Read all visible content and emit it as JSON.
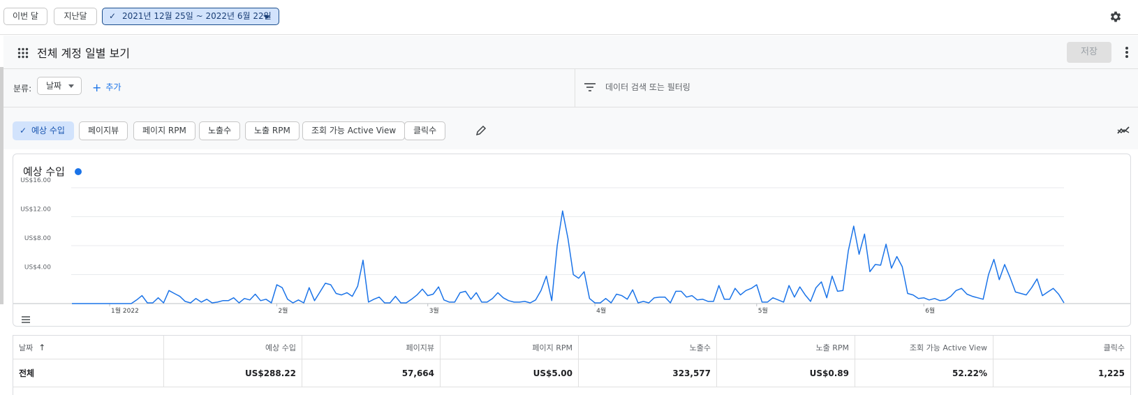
{
  "date_bar": {
    "this_month": "이번 달",
    "last_month": "지난달",
    "range": "2021년 12월 25일 ~ 2022년 6월 22일"
  },
  "report": {
    "title": "전체 계정 일별 보기",
    "save_label": "저장"
  },
  "filters": {
    "breakdown_label": "분류:",
    "breakdown_value": "날짜",
    "add_label": "추가",
    "search_placeholder": "데이터 검색 또는 필터링"
  },
  "metrics": [
    {
      "label": "예상 수입",
      "active": true
    },
    {
      "label": "페이지뷰",
      "active": false
    },
    {
      "label": "페이지 RPM",
      "active": false
    },
    {
      "label": "노출수",
      "active": false
    },
    {
      "label": "노출 RPM",
      "active": false
    },
    {
      "label": "조회 가능 Active View",
      "active": false
    },
    {
      "label": "클릭수",
      "active": false
    }
  ],
  "colors": {
    "accent": "#1a73e8",
    "active_chip": "#d2e3fc"
  },
  "chart_data": {
    "type": "line",
    "title": "예상 수입",
    "y_ticks": [
      "US$4.00",
      "US$8.00",
      "US$12.00",
      "US$16.00"
    ],
    "x_ticks": [
      "1월 2022",
      "2월",
      "3월",
      "4월",
      "5월",
      "6월"
    ],
    "ylim": [
      0,
      16
    ],
    "grid": true,
    "series": [
      {
        "color": "#1a73e8",
        "values": [
          0,
          0,
          0,
          0,
          0,
          0,
          0,
          0,
          0,
          0,
          0,
          0,
          0.5,
          1.1,
          0.1,
          0.1,
          0.8,
          0.1,
          1.8,
          1.4,
          1.0,
          0.3,
          0.1,
          0.7,
          0.2,
          0.6,
          0.1,
          0.2,
          0.4,
          0.4,
          0.8,
          0.1,
          0.7,
          0.5,
          1.3,
          0.4,
          0.6,
          0.1,
          2.6,
          2.2,
          0.6,
          0.1,
          0.5,
          0.1,
          2.2,
          0.4,
          1.6,
          2.8,
          2.6,
          1.4,
          1.2,
          1.5,
          1.0,
          2.4,
          6.0,
          0.2,
          0.6,
          0.9,
          0.1,
          0.1,
          1.0,
          0.1,
          0.1,
          0.6,
          1.2,
          2.0,
          1.1,
          1.3,
          2.3,
          0.5,
          0.2,
          0.2,
          1.5,
          1.7,
          0.6,
          1.5,
          0.2,
          0.2,
          0.7,
          1.5,
          0.8,
          0.4,
          0.2,
          0.2,
          0.3,
          0.1,
          0.5,
          1.8,
          3.8,
          0.4,
          8.0,
          12.8,
          9.0,
          4.0,
          3.5,
          4.4,
          0.7,
          0.1,
          0.1,
          0.7,
          0.1,
          1.3,
          1.1,
          0.6,
          1.9,
          0.1,
          0.3,
          0.1,
          0.8,
          0.9,
          0.9,
          0.1,
          1.7,
          1.7,
          0.9,
          1.1,
          0.5,
          0.6,
          0.3,
          0.3,
          2.5,
          0.6,
          0.6,
          2.1,
          1.2,
          1.8,
          2.1,
          2.6,
          0.2,
          0.2,
          0.8,
          0.5,
          0.2,
          2.5,
          0.9,
          2.3,
          1.2,
          0.3,
          2.2,
          3.0,
          0.8,
          3.8,
          1.7,
          1.8,
          7.3,
          10.7,
          6.8,
          9.6,
          4.4,
          5.4,
          5.3,
          8.2,
          4.9,
          6.5,
          5.1,
          1.4,
          1.2,
          0.7,
          0.8,
          0.5,
          0.7,
          0.4,
          0.5,
          1.0,
          1.8,
          2.1,
          1.3,
          1.0,
          0.8,
          0.6,
          4.0,
          6.1,
          3.3,
          5.4,
          3.6,
          1.6,
          1.4,
          1.2,
          2.2,
          3.4,
          1.1,
          1.6,
          2.1,
          1.3,
          0.1
        ]
      }
    ]
  },
  "table": {
    "headers": [
      "날짜",
      "예상 수입",
      "페이지뷰",
      "페이지 RPM",
      "노출수",
      "노출 RPM",
      "조회 가능 Active View",
      "클릭수"
    ],
    "total_row": [
      "전체",
      "US$288.22",
      "57,664",
      "US$5.00",
      "323,577",
      "US$0.89",
      "52.22%",
      "1,225"
    ]
  }
}
